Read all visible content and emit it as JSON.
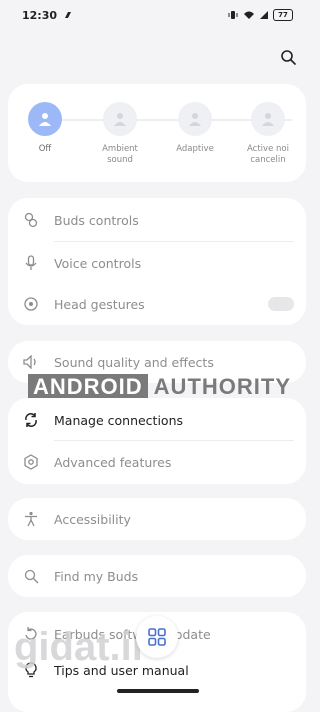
{
  "status": {
    "time": "12:30",
    "battery": "77"
  },
  "modes": [
    {
      "label": "Off",
      "active": true,
      "icon": "person-icon"
    },
    {
      "label": "Ambient\nsound",
      "active": false,
      "icon": "person-icon"
    },
    {
      "label": "Adaptive",
      "active": false,
      "icon": "person-icon"
    },
    {
      "label": "Active noi\ncancelin",
      "active": false,
      "icon": "person-icon"
    }
  ],
  "controls": {
    "buds": "Buds controls",
    "voice": "Voice controls",
    "head": "Head gestures"
  },
  "sound": "Sound quality and effects",
  "connections": {
    "manage": "Manage connections",
    "advanced": "Advanced features"
  },
  "accessibility": "Accessibility",
  "find": "Find my Buds",
  "more": {
    "software": "Earbuds software update",
    "tips": "Tips and user manual"
  },
  "watermark": {
    "left": "ANDROID",
    "right": "AUTHORITY"
  },
  "gidat": "gidat.ir",
  "colors": {
    "accent": "#9cb8f7",
    "background": "#f4f4f6",
    "card": "#ffffff"
  }
}
